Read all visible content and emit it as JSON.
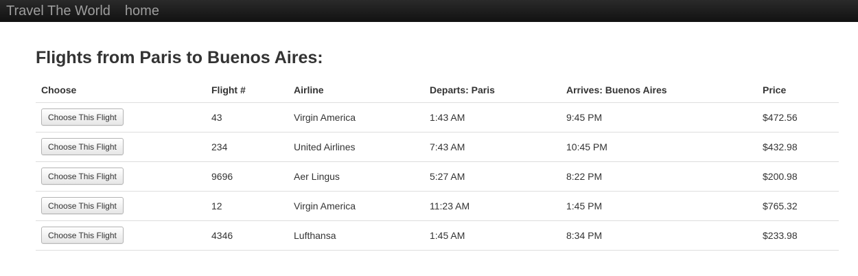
{
  "navbar": {
    "brand": "Travel The World",
    "links": [
      "home"
    ]
  },
  "main": {
    "title": "Flights from Paris to Buenos Aires:",
    "table": {
      "headers": [
        "Choose",
        "Flight #",
        "Airline",
        "Departs: Paris",
        "Arrives: Buenos Aires",
        "Price"
      ],
      "button_label": "Choose This Flight",
      "rows": [
        {
          "flight": "43",
          "airline": "Virgin America",
          "departs": "1:43 AM",
          "arrives": "9:45 PM",
          "price": "$472.56"
        },
        {
          "flight": "234",
          "airline": "United Airlines",
          "departs": "7:43 AM",
          "arrives": "10:45 PM",
          "price": "$432.98"
        },
        {
          "flight": "9696",
          "airline": "Aer Lingus",
          "departs": "5:27 AM",
          "arrives": "8:22 PM",
          "price": "$200.98"
        },
        {
          "flight": "12",
          "airline": "Virgin America",
          "departs": "11:23 AM",
          "arrives": "1:45 PM",
          "price": "$765.32"
        },
        {
          "flight": "4346",
          "airline": "Lufthansa",
          "departs": "1:45 AM",
          "arrives": "8:34 PM",
          "price": "$233.98"
        }
      ]
    }
  }
}
